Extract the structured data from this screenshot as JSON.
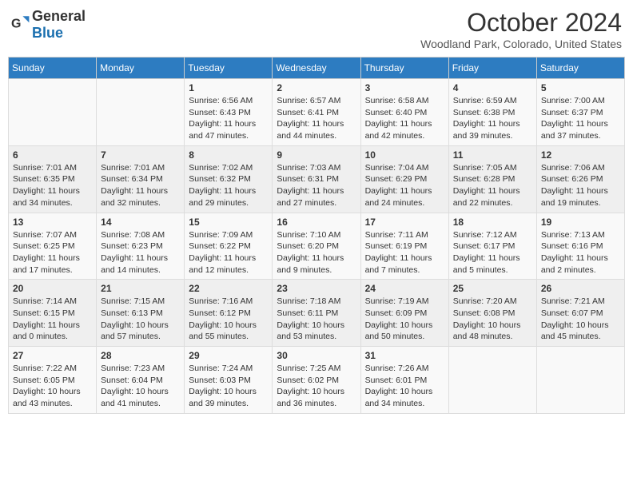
{
  "header": {
    "logo_general": "General",
    "logo_blue": "Blue",
    "month_title": "October 2024",
    "location": "Woodland Park, Colorado, United States"
  },
  "days_of_week": [
    "Sunday",
    "Monday",
    "Tuesday",
    "Wednesday",
    "Thursday",
    "Friday",
    "Saturday"
  ],
  "weeks": [
    [
      {
        "day": "",
        "info": ""
      },
      {
        "day": "",
        "info": ""
      },
      {
        "day": "1",
        "info": "Sunrise: 6:56 AM\nSunset: 6:43 PM\nDaylight: 11 hours and 47 minutes."
      },
      {
        "day": "2",
        "info": "Sunrise: 6:57 AM\nSunset: 6:41 PM\nDaylight: 11 hours and 44 minutes."
      },
      {
        "day": "3",
        "info": "Sunrise: 6:58 AM\nSunset: 6:40 PM\nDaylight: 11 hours and 42 minutes."
      },
      {
        "day": "4",
        "info": "Sunrise: 6:59 AM\nSunset: 6:38 PM\nDaylight: 11 hours and 39 minutes."
      },
      {
        "day": "5",
        "info": "Sunrise: 7:00 AM\nSunset: 6:37 PM\nDaylight: 11 hours and 37 minutes."
      }
    ],
    [
      {
        "day": "6",
        "info": "Sunrise: 7:01 AM\nSunset: 6:35 PM\nDaylight: 11 hours and 34 minutes."
      },
      {
        "day": "7",
        "info": "Sunrise: 7:01 AM\nSunset: 6:34 PM\nDaylight: 11 hours and 32 minutes."
      },
      {
        "day": "8",
        "info": "Sunrise: 7:02 AM\nSunset: 6:32 PM\nDaylight: 11 hours and 29 minutes."
      },
      {
        "day": "9",
        "info": "Sunrise: 7:03 AM\nSunset: 6:31 PM\nDaylight: 11 hours and 27 minutes."
      },
      {
        "day": "10",
        "info": "Sunrise: 7:04 AM\nSunset: 6:29 PM\nDaylight: 11 hours and 24 minutes."
      },
      {
        "day": "11",
        "info": "Sunrise: 7:05 AM\nSunset: 6:28 PM\nDaylight: 11 hours and 22 minutes."
      },
      {
        "day": "12",
        "info": "Sunrise: 7:06 AM\nSunset: 6:26 PM\nDaylight: 11 hours and 19 minutes."
      }
    ],
    [
      {
        "day": "13",
        "info": "Sunrise: 7:07 AM\nSunset: 6:25 PM\nDaylight: 11 hours and 17 minutes."
      },
      {
        "day": "14",
        "info": "Sunrise: 7:08 AM\nSunset: 6:23 PM\nDaylight: 11 hours and 14 minutes."
      },
      {
        "day": "15",
        "info": "Sunrise: 7:09 AM\nSunset: 6:22 PM\nDaylight: 11 hours and 12 minutes."
      },
      {
        "day": "16",
        "info": "Sunrise: 7:10 AM\nSunset: 6:20 PM\nDaylight: 11 hours and 9 minutes."
      },
      {
        "day": "17",
        "info": "Sunrise: 7:11 AM\nSunset: 6:19 PM\nDaylight: 11 hours and 7 minutes."
      },
      {
        "day": "18",
        "info": "Sunrise: 7:12 AM\nSunset: 6:17 PM\nDaylight: 11 hours and 5 minutes."
      },
      {
        "day": "19",
        "info": "Sunrise: 7:13 AM\nSunset: 6:16 PM\nDaylight: 11 hours and 2 minutes."
      }
    ],
    [
      {
        "day": "20",
        "info": "Sunrise: 7:14 AM\nSunset: 6:15 PM\nDaylight: 11 hours and 0 minutes."
      },
      {
        "day": "21",
        "info": "Sunrise: 7:15 AM\nSunset: 6:13 PM\nDaylight: 10 hours and 57 minutes."
      },
      {
        "day": "22",
        "info": "Sunrise: 7:16 AM\nSunset: 6:12 PM\nDaylight: 10 hours and 55 minutes."
      },
      {
        "day": "23",
        "info": "Sunrise: 7:18 AM\nSunset: 6:11 PM\nDaylight: 10 hours and 53 minutes."
      },
      {
        "day": "24",
        "info": "Sunrise: 7:19 AM\nSunset: 6:09 PM\nDaylight: 10 hours and 50 minutes."
      },
      {
        "day": "25",
        "info": "Sunrise: 7:20 AM\nSunset: 6:08 PM\nDaylight: 10 hours and 48 minutes."
      },
      {
        "day": "26",
        "info": "Sunrise: 7:21 AM\nSunset: 6:07 PM\nDaylight: 10 hours and 45 minutes."
      }
    ],
    [
      {
        "day": "27",
        "info": "Sunrise: 7:22 AM\nSunset: 6:05 PM\nDaylight: 10 hours and 43 minutes."
      },
      {
        "day": "28",
        "info": "Sunrise: 7:23 AM\nSunset: 6:04 PM\nDaylight: 10 hours and 41 minutes."
      },
      {
        "day": "29",
        "info": "Sunrise: 7:24 AM\nSunset: 6:03 PM\nDaylight: 10 hours and 39 minutes."
      },
      {
        "day": "30",
        "info": "Sunrise: 7:25 AM\nSunset: 6:02 PM\nDaylight: 10 hours and 36 minutes."
      },
      {
        "day": "31",
        "info": "Sunrise: 7:26 AM\nSunset: 6:01 PM\nDaylight: 10 hours and 34 minutes."
      },
      {
        "day": "",
        "info": ""
      },
      {
        "day": "",
        "info": ""
      }
    ]
  ]
}
